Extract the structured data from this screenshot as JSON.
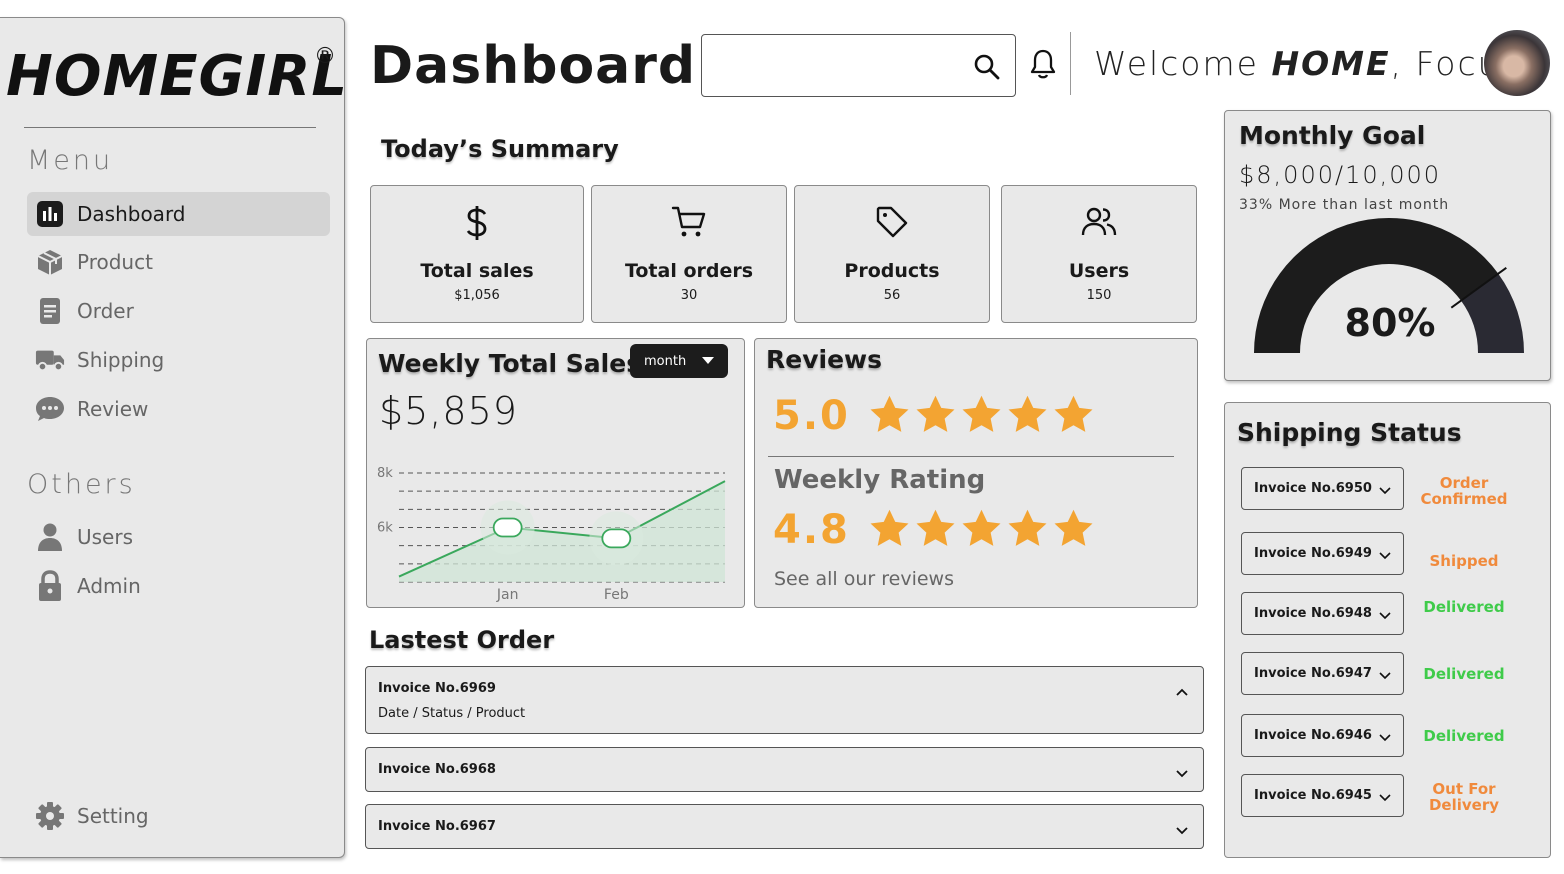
{
  "brand": {
    "name": "HOMEGIRL",
    "reg_mark": "®"
  },
  "sidebar": {
    "menu_heading": "Menu",
    "menu_items": [
      {
        "label": "Dashboard",
        "icon": "chart-bars-icon",
        "active": true
      },
      {
        "label": "Product",
        "icon": "box-icon"
      },
      {
        "label": "Order",
        "icon": "document-icon"
      },
      {
        "label": "Shipping",
        "icon": "truck-icon"
      },
      {
        "label": "Review",
        "icon": "chat-bubble-icon"
      }
    ],
    "others_heading": "Others",
    "others_items": [
      {
        "label": "Users",
        "icon": "user-icon"
      },
      {
        "label": "Admin",
        "icon": "lock-icon"
      }
    ],
    "setting_label": "Setting"
  },
  "header": {
    "title": "Dashboard",
    "search_placeholder": "",
    "welcome_prefix": "Welcome ",
    "welcome_bold": "HOME",
    "welcome_suffix": ", Focus"
  },
  "summary": {
    "title": "Today’s Summary",
    "cards": [
      {
        "label": "Total sales",
        "value": "$1,056",
        "icon": "dollar-icon"
      },
      {
        "label": "Total orders",
        "value": "30",
        "icon": "cart-icon"
      },
      {
        "label": "Products",
        "value": "56",
        "icon": "tag-icon"
      },
      {
        "label": "Users",
        "value": "150",
        "icon": "users-icon"
      }
    ]
  },
  "weekly_sales": {
    "title": "Weekly Total Sales",
    "value": "$5,859",
    "period_select": "month"
  },
  "chart_data": {
    "type": "area",
    "categories": [
      "Jan",
      "Feb"
    ],
    "y_tick_labels": [
      "8k",
      "6k"
    ],
    "ylim": [
      4000,
      8000
    ],
    "x": [
      0,
      1,
      2,
      3
    ],
    "series": [
      {
        "values": [
          4200,
          6000,
          5600,
          7700
        ]
      }
    ],
    "point_markers": [
      1,
      2
    ],
    "grid": true,
    "colors": {
      "line": "#3aa85c",
      "fill": "#cfe4d5"
    }
  },
  "reviews": {
    "title": "Reviews",
    "rating": "5.0",
    "rating_stars": 5,
    "weekly_title": "Weekly Rating",
    "weekly_rating": "4.8",
    "weekly_stars": 5,
    "see_all": "See all our reviews",
    "star_color": "#f3a432"
  },
  "latest_order": {
    "title": "Lastest Order",
    "orders": [
      {
        "invoice": "Invoice No.6969",
        "detail": "Date / Status / Product",
        "expanded": true
      },
      {
        "invoice": "Invoice No.6968",
        "expanded": false
      },
      {
        "invoice": "Invoice No.6967",
        "expanded": false
      }
    ]
  },
  "monthly_goal": {
    "title": "Monthly Goal",
    "amount": "$8,000/10,000",
    "note": "33% More than last month",
    "percent_label": "80%",
    "percent": 0.8
  },
  "shipping": {
    "title": "Shipping Status",
    "items": [
      {
        "invoice": "Invoice No.6950",
        "status": "Order Confirmed",
        "color": "#f08a3c"
      },
      {
        "invoice": "Invoice No.6949",
        "status": "Shipped",
        "color": "#f08a3c"
      },
      {
        "invoice": "Invoice No.6948",
        "status": "Delivered",
        "color": "#3fcb4a"
      },
      {
        "invoice": "Invoice No.6947",
        "status": "Delivered",
        "color": "#3fcb4a"
      },
      {
        "invoice": "Invoice No.6946",
        "status": "Delivered",
        "color": "#3fcb4a"
      },
      {
        "invoice": "Invoice No.6945",
        "status": "Out For Delivery",
        "color": "#f08a3c"
      }
    ]
  }
}
